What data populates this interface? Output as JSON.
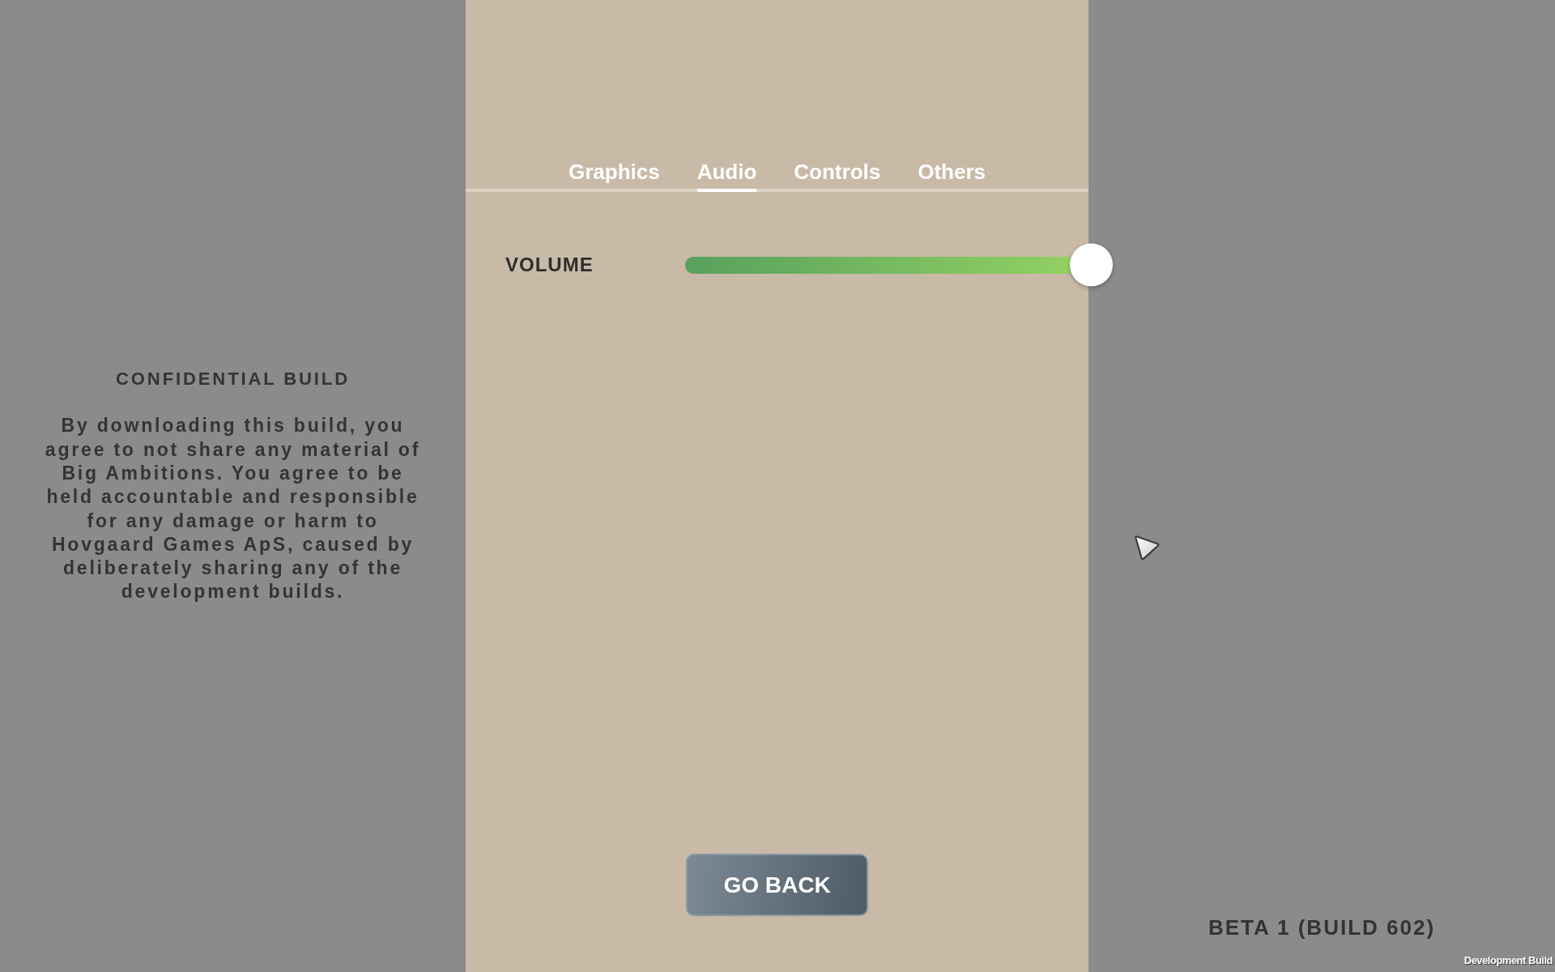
{
  "notice": {
    "title": "CONFIDENTIAL BUILD",
    "text": "By downloading this build, you agree to not share any material of Big Ambitions. You agree to be held accountable and responsible for any damage or harm to Hovgaard Games ApS, caused by deliberately sharing any of the development builds."
  },
  "settings_panel": {
    "tabs": [
      {
        "label": "Graphics",
        "selected": false
      },
      {
        "label": "Audio",
        "selected": true
      },
      {
        "label": "Controls",
        "selected": false
      },
      {
        "label": "Others",
        "selected": false
      }
    ],
    "settings": [
      {
        "kind": "slider",
        "label": "VOLUME",
        "level": 1
      }
    ],
    "back_button": "GO BACK"
  },
  "version": "BETA 1 (BUILD 602)",
  "build_label": "Development Build"
}
